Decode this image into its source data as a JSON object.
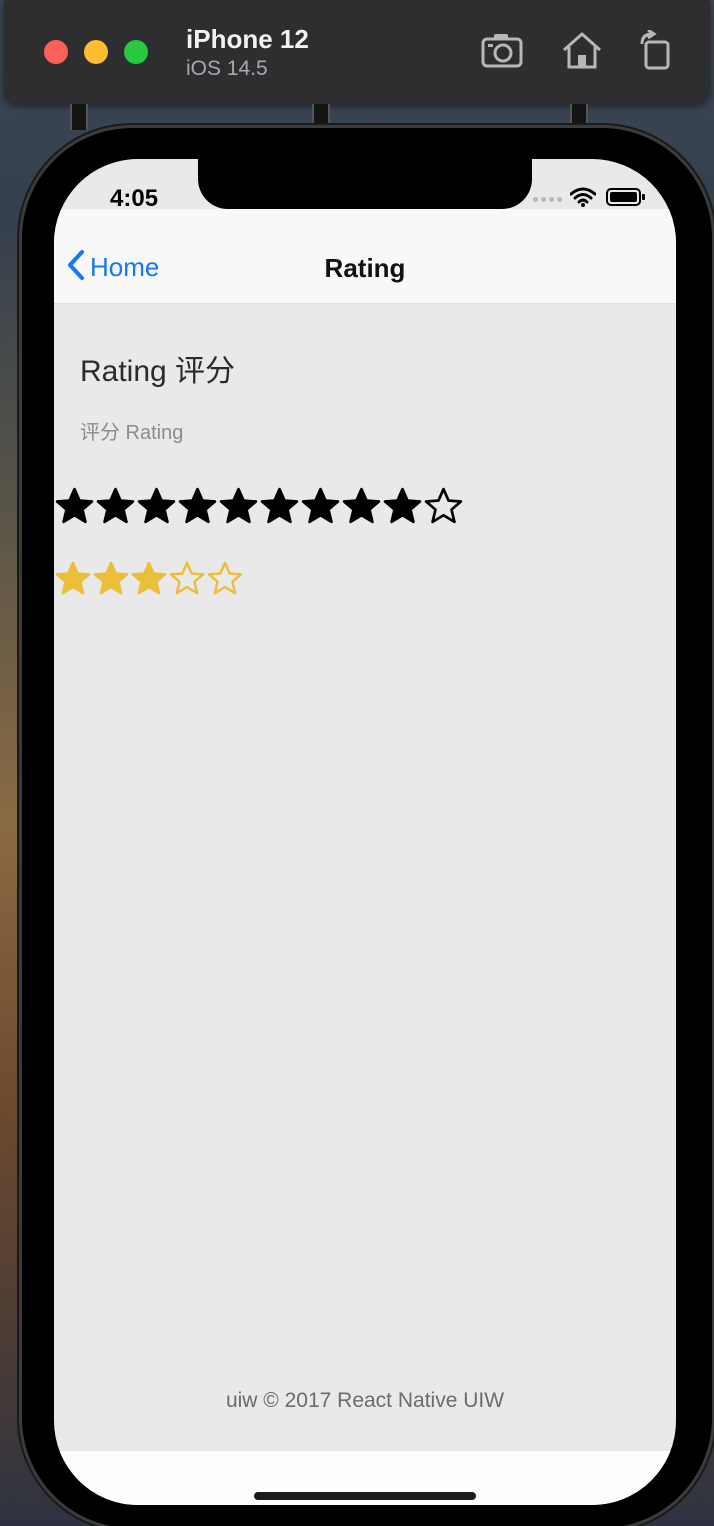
{
  "simulator": {
    "device_name": "iPhone 12",
    "os_version": "iOS 14.5",
    "icons": [
      "screenshot-icon",
      "home-icon",
      "rotate-icon"
    ]
  },
  "status_bar": {
    "time": "4:05",
    "icons": [
      "cellular-icon",
      "wifi-icon",
      "battery-icon"
    ]
  },
  "navbar": {
    "back_label": "Home",
    "title": "Rating"
  },
  "page": {
    "title": "Rating 评分",
    "section_label": "评分 Rating"
  },
  "ratings": [
    {
      "name": "black-rating",
      "count": 10,
      "value": 9,
      "color": "#000000"
    },
    {
      "name": "gold-rating",
      "count": 5,
      "value": 3,
      "color": "#ebbf3a"
    }
  ],
  "footer": {
    "text": "uiw © 2017 React Native UIW"
  },
  "colors": {
    "accent": "#1877f2",
    "content_background": "#e9e9e9"
  }
}
